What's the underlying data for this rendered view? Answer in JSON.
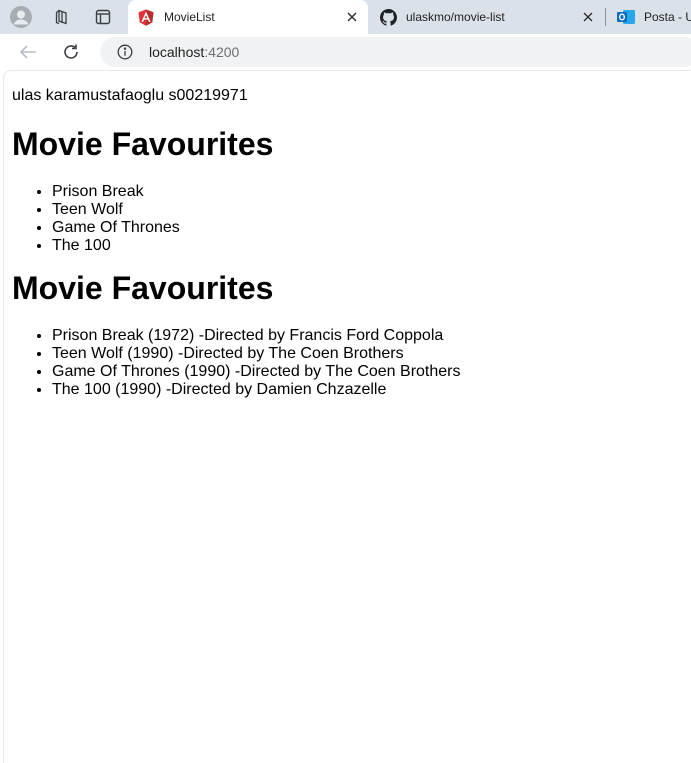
{
  "browser": {
    "tabs": [
      {
        "title": "MovieList",
        "icon": "angular-icon",
        "active": true
      },
      {
        "title": "ulaskmo/movie-list",
        "icon": "github-icon",
        "active": false
      },
      {
        "title": "Posta - U",
        "icon": "outlook-icon",
        "active": false
      }
    ],
    "address": {
      "host": "localhost",
      "port": ":4200"
    }
  },
  "page": {
    "student": "ulas karamustafaoglu s00219971",
    "section1": {
      "heading": "Movie Favourites",
      "items": [
        "Prison Break",
        "Teen Wolf",
        "Game Of Thrones",
        "The 100"
      ]
    },
    "section2": {
      "heading": "Movie Favourites",
      "items": [
        "Prison Break (1972) -Directed by Francis Ford Coppola",
        "Teen Wolf (1990) -Directed by The Coen Brothers",
        "Game Of Thrones (1990) -Directed by The Coen Brothers",
        "The 100 (1990) -Directed by Damien Chzazelle"
      ]
    }
  },
  "colors": {
    "tabstrip": "#dbe1e8",
    "angular": "#e23237",
    "outlook": "#0f6cbd"
  }
}
